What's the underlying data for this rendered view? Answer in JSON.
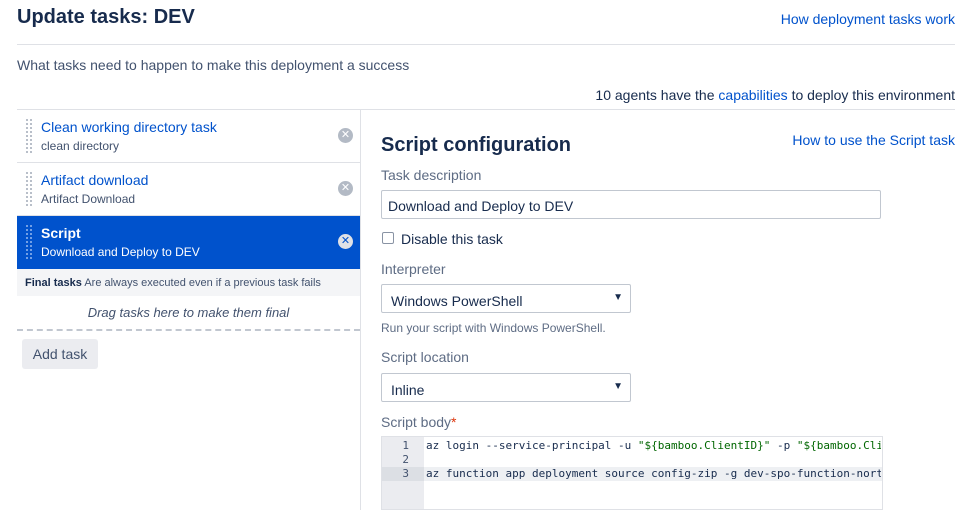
{
  "header": {
    "title": "Update tasks: DEV",
    "help_link": "How deployment tasks work",
    "subtitle": "What tasks need to happen to make this deployment a success"
  },
  "agents": {
    "prefix": "10 agents have the",
    "link": "capabilities",
    "suffix": "to deploy this environment"
  },
  "tasks": [
    {
      "name": "Clean working directory task",
      "description": "clean directory",
      "active": false
    },
    {
      "name": "Artifact download",
      "description": "Artifact Download",
      "active": false
    },
    {
      "name": "Script",
      "description": "Download and Deploy to DEV",
      "active": true
    }
  ],
  "final_tasks": {
    "label": "Final tasks",
    "note": "Are always executed even if a previous task fails",
    "drop_hint": "Drag tasks here to make them final"
  },
  "add_task_label": "Add task",
  "config": {
    "title": "Script configuration",
    "help_link": "How to use the Script task",
    "task_description_label": "Task description",
    "task_description_value": "Download and Deploy to DEV",
    "disable_label": "Disable this task",
    "disable_checked": false,
    "interpreter_label": "Interpreter",
    "interpreter_value": "Windows PowerShell",
    "interpreter_hint": "Run your script with Windows PowerShell.",
    "location_label": "Script location",
    "location_value": "Inline",
    "body_label": "Script body",
    "required_marker": "*",
    "code_lines": [
      {
        "num": "1",
        "before": "az login --service-principal -u ",
        "str1": "\"${bamboo.ClientID}\"",
        "mid": " -p ",
        "str2": "\"${bamboo.Cli"
      },
      {
        "num": "2",
        "text": ""
      },
      {
        "num": "3",
        "text": "az function app deployment source config-zip -g dev-spo-function-northe"
      }
    ]
  },
  "icons": {
    "remove": "remove-circle-icon",
    "grip": "drag-handle-icon",
    "caret": "chevron-down-icon"
  },
  "colors": {
    "accent": "#0052cc",
    "active_task_bg": "#0052cc",
    "required": "#de350b"
  }
}
